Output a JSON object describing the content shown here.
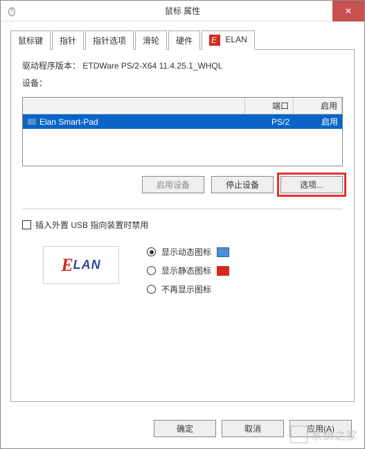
{
  "title": "鼠标 属性",
  "close_icon": "✕",
  "tabs": {
    "t0": "鼠标键",
    "t1": "指针",
    "t2": "指针选项",
    "t3": "滑轮",
    "t4": "硬件",
    "t5": "ELAN"
  },
  "driver": {
    "label": "驱动程序版本：",
    "value": "ETDWare PS/2-X64 11.4.25.1_WHQL"
  },
  "device_label": "设备：",
  "table": {
    "h1": "端口",
    "h2": "启用",
    "row": {
      "name": "Elan Smart-Pad",
      "port": "PS/2",
      "enable": "启用"
    }
  },
  "buttons": {
    "enable": "启用设备",
    "stop": "停止设备",
    "options": "选项..."
  },
  "usb_checkbox": "插入外置 USB 指向装置时禁用",
  "radios": {
    "r0": "显示动态图标",
    "r1": "显示静态图标",
    "r2": "不再显示图标"
  },
  "dialog_buttons": {
    "ok": "确定",
    "cancel": "取消",
    "apply": "应用(A)"
  },
  "watermark": "系统之家"
}
